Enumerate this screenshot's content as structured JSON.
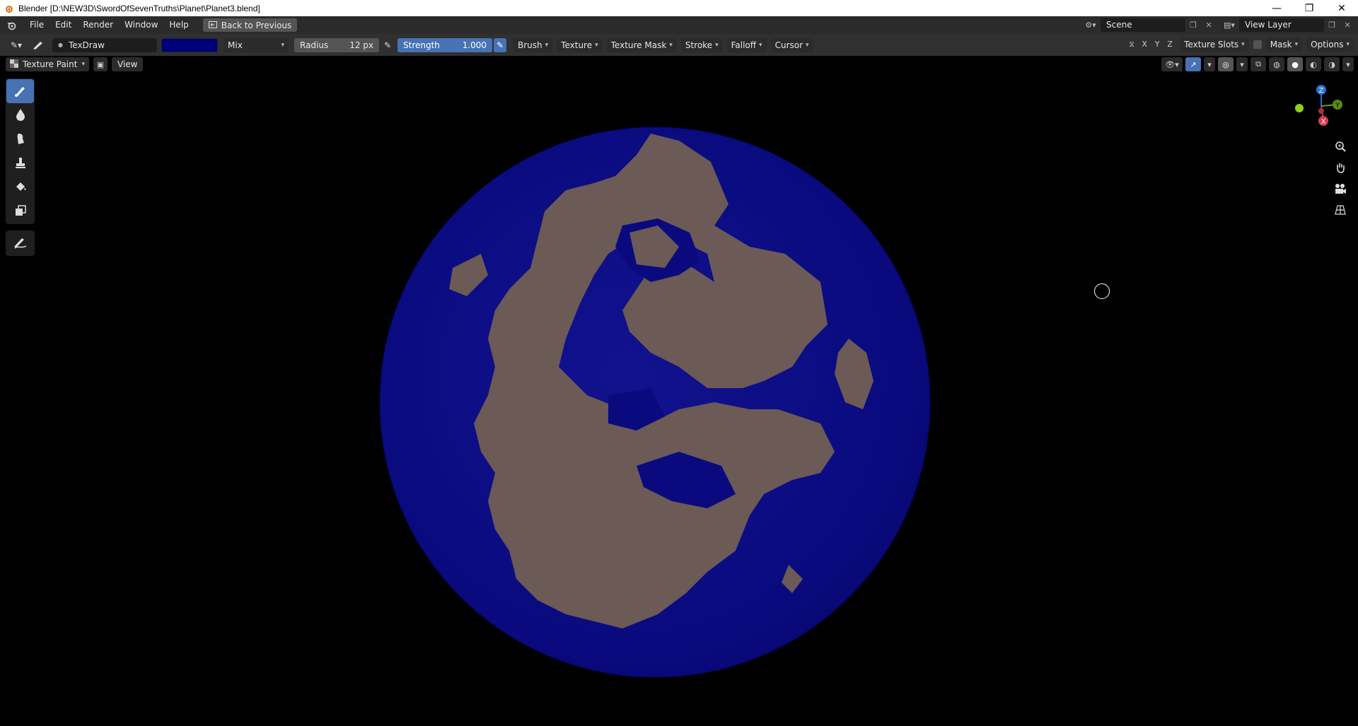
{
  "window": {
    "title": "Blender [D:\\NEW3D\\SwordOfSevenTruths\\Planet\\Planet3.blend]",
    "controls": {
      "minimize": "—",
      "maximize": "❐",
      "close": "✕"
    }
  },
  "menubar": {
    "items": [
      "File",
      "Edit",
      "Render",
      "Window",
      "Help"
    ],
    "back_button": "Back to Previous",
    "scene": "Scene",
    "view_layer": "View Layer"
  },
  "toolheader": {
    "brush_name": "TexDraw",
    "brush_color": "#00007a",
    "blend_mode": "Mix",
    "radius_label": "Radius",
    "radius_value": "12 px",
    "strength_label": "Strength",
    "strength_value": "1.000",
    "menus": [
      "Brush",
      "Texture",
      "Texture Mask",
      "Stroke",
      "Falloff",
      "Cursor"
    ],
    "axes": [
      "X",
      "Y",
      "Z"
    ],
    "texture_slots": "Texture Slots",
    "mask": "Mask",
    "options": "Options"
  },
  "viewport": {
    "mode": "Texture Paint",
    "view_menu": "View",
    "gizmo": {
      "z": "Z",
      "y": "Y",
      "x": "X"
    }
  },
  "tools": [
    "draw-brush",
    "soften-brush",
    "smear-brush",
    "clone-brush",
    "fill-brush",
    "mask-brush",
    "annotate"
  ],
  "colors": {
    "ocean": "#0a0a82",
    "land": "#6b5a55",
    "accent": "#4772b3",
    "background": "#000000"
  }
}
